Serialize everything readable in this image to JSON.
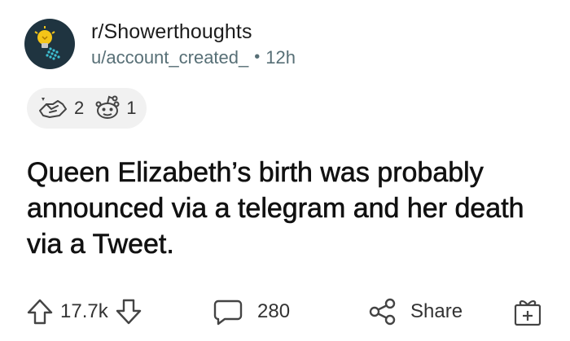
{
  "post": {
    "subreddit": "r/Showerthoughts",
    "author": "u/account_created_",
    "separator": "•",
    "age": "12h",
    "title": "Queen Elizabeth’s birth was probably announced via a telegram and her death via a Tweet."
  },
  "awards": [
    {
      "icon": "helping-hand-award-icon",
      "count": "2"
    },
    {
      "icon": "wholesome-snoo-award-icon",
      "count": "1"
    }
  ],
  "actions": {
    "upvotes": "17.7k",
    "comments": "280",
    "share_label": "Share"
  },
  "icons": {
    "avatar": "lightbulb-shower-icon",
    "upvote": "arrow-up-icon",
    "downvote": "arrow-down-icon",
    "comment": "comment-bubble-icon",
    "share": "share-icon",
    "award": "gift-icon"
  },
  "colors": {
    "avatar_bg": "#1f3440",
    "bulb": "#f5c518",
    "water": "#3ec1d3",
    "pill_bg": "#f1f1f1",
    "meta_text": "#576f76"
  }
}
